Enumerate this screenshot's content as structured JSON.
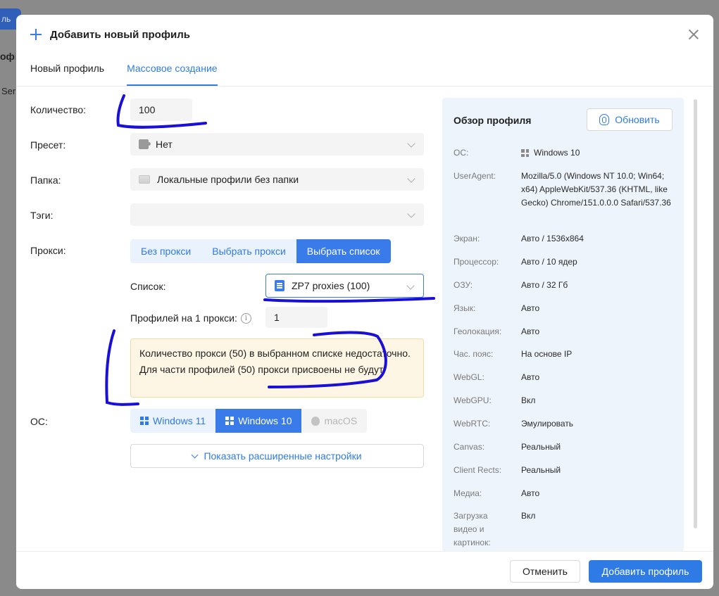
{
  "background": {
    "button_text": "ль",
    "heading_fragment": "офі",
    "text_fragment": "Ser"
  },
  "modal": {
    "title": "Добавить новый профиль",
    "tabs": [
      "Новый профиль",
      "Массовое создание"
    ],
    "active_tab": "Массовое создание"
  },
  "form": {
    "quantity_label": "Количество:",
    "quantity_value": "100",
    "preset_label": "Пресет:",
    "preset_value": "Нет",
    "folder_label": "Папка:",
    "folder_value": "Локальные профили без папки",
    "tags_label": "Тэги:",
    "tags_value": "",
    "proxy_label": "Прокси:",
    "proxy_options": [
      "Без прокси",
      "Выбрать прокси",
      "Выбрать список"
    ],
    "proxy_selected": "Выбрать список",
    "list_label": "Список:",
    "list_value": "ZP7 proxies (100)",
    "per_proxy_label": "Профилей на 1 прокси:",
    "per_proxy_value": "1",
    "warning_text": "Количество прокси (50) в выбранном списке недостаточно. Для части профилей (50) прокси присвоены не будут.",
    "os_label": "ОС:",
    "os_options": [
      "Windows 11",
      "Windows 10",
      "macOS"
    ],
    "os_selected": "Windows 10",
    "advanced_label": "Показать расширенные настройки"
  },
  "overview": {
    "title": "Обзор профиля",
    "refresh_label": "Обновить",
    "rows": [
      {
        "key": "ОС:",
        "value": "Windows 10"
      },
      {
        "key": "UserAgent:",
        "value": "Mozilla/5.0 (Windows NT 10.0; Win64; x64) AppleWebKit/537.36 (KHTML, like Gecko) Chrome/151.0.0.0 Safari/537.36"
      },
      {
        "key": "Экран:",
        "value": "Авто / 1536x864"
      },
      {
        "key": "Процессор:",
        "value": "Авто / 10 ядер"
      },
      {
        "key": "ОЗУ:",
        "value": "Авто / 32 Гб"
      },
      {
        "key": "Язык:",
        "value": "Авто"
      },
      {
        "key": "Геолокация:",
        "value": "Авто"
      },
      {
        "key": "Час. пояс:",
        "value": "На основе IP"
      },
      {
        "key": "WebGL:",
        "value": "Авто"
      },
      {
        "key": "WebGPU:",
        "value": "Вкл"
      },
      {
        "key": "WebRTC:",
        "value": "Эмулировать"
      },
      {
        "key": "Canvas:",
        "value": "Реальный"
      },
      {
        "key": "Client Rects:",
        "value": "Реальный"
      },
      {
        "key": "Медиа:",
        "value": "Авто"
      },
      {
        "key": "Загрузка видео и картинок:",
        "value": "Вкл"
      }
    ]
  },
  "footer": {
    "cancel_label": "Отменить",
    "add_label": "Добавить профиль"
  },
  "colors": {
    "accent": "#2f7be5",
    "warning_bg": "#fdf6e4",
    "overview_bg": "#eef4fc",
    "annotation_ink": "#1a0fd6"
  }
}
